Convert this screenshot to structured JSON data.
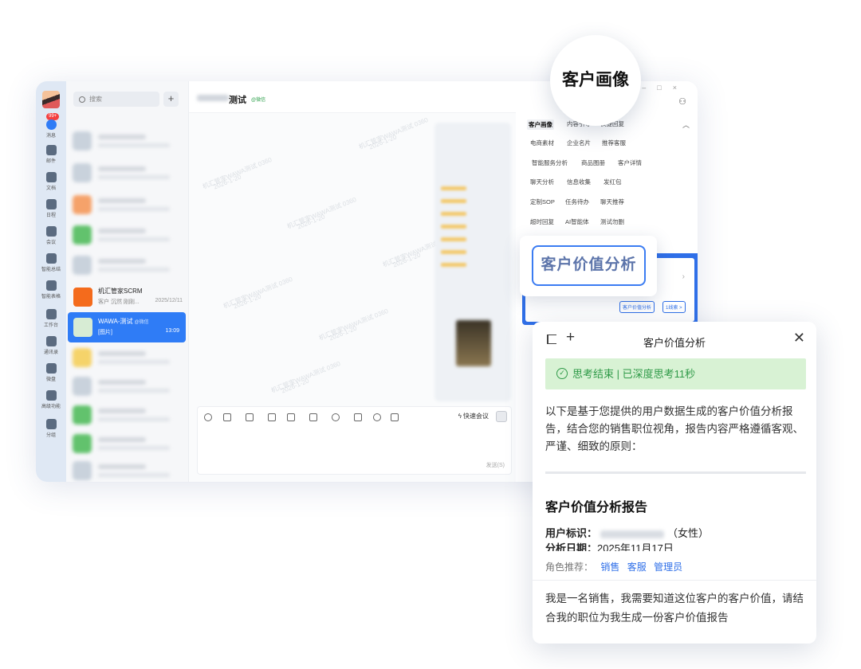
{
  "callouts": {
    "portrait": "客户画像",
    "value_analysis": "客户价值分析"
  },
  "rail": {
    "badge": "99+",
    "items": [
      "消息",
      "邮件",
      "文档",
      "日程",
      "会议",
      "智能总结",
      "智能表格",
      "工作台",
      "通讯录",
      "微盘",
      "高级功能",
      "分组"
    ]
  },
  "chat_list": {
    "search_placeholder": "搜索",
    "add_symbol": "+",
    "items": [
      {
        "name": "机汇管家SCRM",
        "subtitle": "客户 沉然 刚刚...",
        "time": "2025/12/11"
      },
      {
        "name": "WAWA-测试",
        "tag": "@微信",
        "subtitle": "[图片]",
        "time": "13:09"
      }
    ]
  },
  "chat": {
    "title": "测试",
    "title_tag": "@微信",
    "watermark": "机汇管家WAWA测试 0360",
    "watermark_date": "2026-1-20",
    "quick_meeting": "快速会议",
    "send_hint": "发送(S)"
  },
  "side": {
    "tabs": [
      "客户画像",
      "内容引导",
      "快捷回复",
      "电商素材",
      "企业名片",
      "推荐客服",
      "智能服务分析",
      "商品图册",
      "客户详情",
      "聊天分析",
      "信息收集",
      "发红包",
      "定制SOP",
      "任务待办",
      "聊天推荐",
      "超时回复",
      "AI智能体",
      "测试勿删"
    ],
    "card_buttons": [
      "客户价值分析",
      "1线索 >"
    ]
  },
  "panel": {
    "title": "客户价值分析",
    "status": "思考结束 | 已深度思考11秒",
    "intro": "以下是基于您提供的用户数据生成的客户价值分析报告，结合您的销售职位视角，报告内容严格遵循客观、严谨、细致的原则：",
    "report_title": "客户价值分析报告",
    "user_id_label": "用户标识：",
    "user_gender": "（女性）",
    "date_label": "分析日期：",
    "date_value": "2025年11月17日",
    "roles_label": "角色推荐：",
    "roles": [
      "销售",
      "客服",
      "管理员"
    ],
    "query": "我是一名销售，我需要知道这位客户的客户价值，请结合我的职位为我生成一份客户价值报告"
  }
}
